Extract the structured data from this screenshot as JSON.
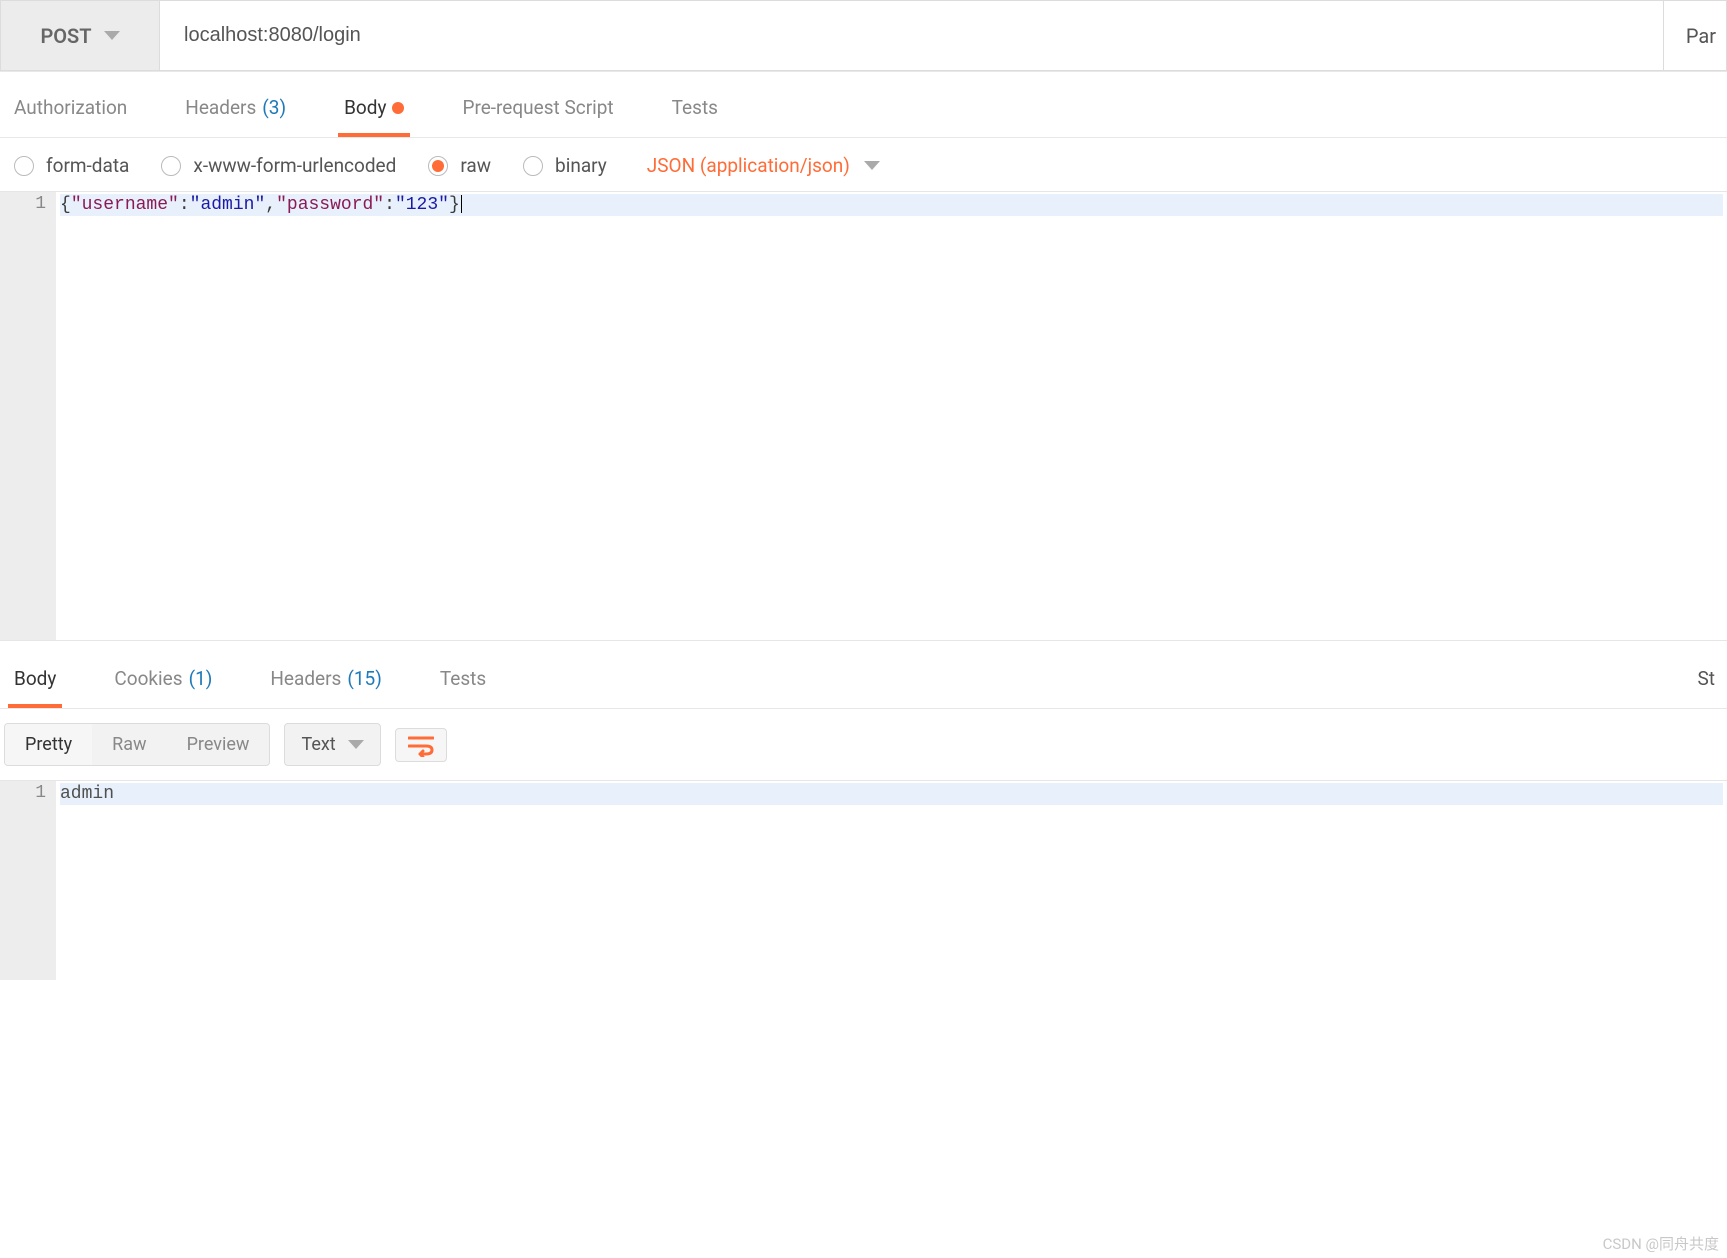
{
  "request": {
    "method": "POST",
    "url": "localhost:8080/login",
    "params_button": "Par"
  },
  "tabs": {
    "authorization": "Authorization",
    "headers_label": "Headers",
    "headers_count": "(3)",
    "body": "Body",
    "prerequest": "Pre-request Script",
    "tests": "Tests"
  },
  "body_types": {
    "form_data": "form-data",
    "urlencoded": "x-www-form-urlencoded",
    "raw": "raw",
    "binary": "binary",
    "content_type": "JSON (application/json)"
  },
  "request_body": {
    "line_no": "1",
    "tokens": {
      "open": "{",
      "k1": "\"username\"",
      "c1": ":",
      "v1": "\"admin\"",
      "comma": ",",
      "k2": "\"password\"",
      "c2": ":",
      "v2": "\"123\"",
      "close": "}"
    }
  },
  "response_tabs": {
    "body": "Body",
    "cookies_label": "Cookies",
    "cookies_count": "(1)",
    "headers_label": "Headers",
    "headers_count": "(15)",
    "tests": "Tests",
    "status_label": "St"
  },
  "resp_toolbar": {
    "pretty": "Pretty",
    "raw": "Raw",
    "preview": "Preview",
    "format": "Text"
  },
  "response_body": {
    "line_no": "1",
    "content": "admin"
  },
  "watermark": "CSDN @同舟共度"
}
